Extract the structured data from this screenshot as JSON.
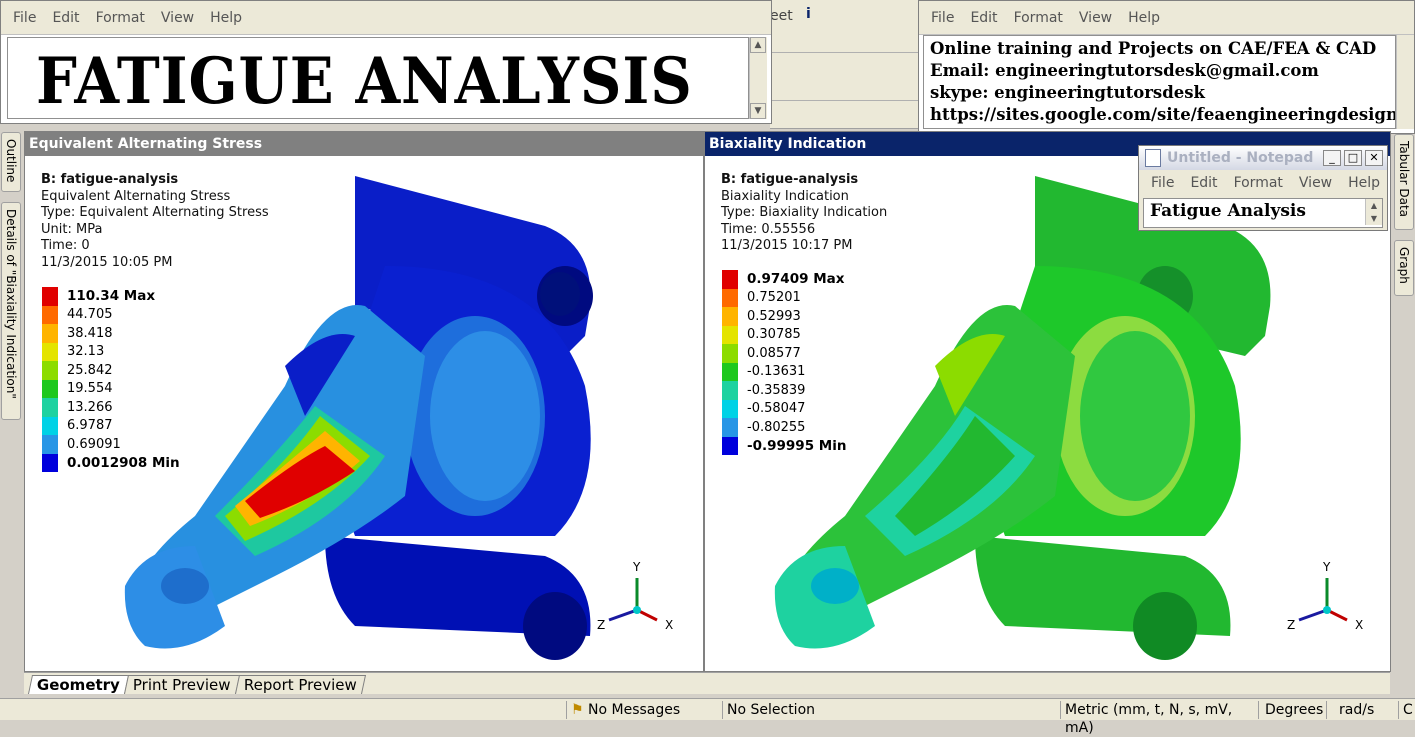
{
  "left_notepad": {
    "menu": [
      "File",
      "Edit",
      "Format",
      "View",
      "Help"
    ],
    "text": "FATIGUE ANALYSIS"
  },
  "bg_toolbar": {
    "partial_text": "eet",
    "info_glyph": "i"
  },
  "right_notepad": {
    "menu": [
      "File",
      "Edit",
      "Format",
      "View",
      "Help"
    ],
    "lines": [
      "Online training and Projects on CAE/FEA & CAD",
      "Email: engineeringtutorsdesk@gmail.com",
      "skype: engineeringtutorsdesk",
      "https://sites.google.com/site/feaengineeringdesign/"
    ]
  },
  "small_notepad": {
    "title": "Untitled - Notepad",
    "menu": [
      "File",
      "Edit",
      "Format",
      "View",
      "Help"
    ],
    "text": "Fatigue Analysis"
  },
  "side_tabs": {
    "left": [
      "Outline",
      "Details of \"Biaxiality Indication\""
    ],
    "right": [
      "Tabular Data",
      "Graph"
    ]
  },
  "panel_left": {
    "title": "Equivalent Alternating Stress",
    "info": {
      "system": "B: fatigue-analysis",
      "result": "Equivalent Alternating Stress",
      "type": "Type: Equivalent Alternating Stress",
      "unit": "Unit: MPa",
      "time": "Time: 0",
      "date": "11/3/2015 10:05 PM"
    },
    "legend": [
      {
        "label": "110.34 Max",
        "color": "#e00000",
        "bold": true
      },
      {
        "label": "44.705",
        "color": "#ff6a00"
      },
      {
        "label": "38.418",
        "color": "#ffb400"
      },
      {
        "label": "32.13",
        "color": "#e4e400"
      },
      {
        "label": "25.842",
        "color": "#8cdc00"
      },
      {
        "label": "19.554",
        "color": "#1ec81e"
      },
      {
        "label": "13.266",
        "color": "#1ed2a0"
      },
      {
        "label": "6.9787",
        "color": "#00d2e6"
      },
      {
        "label": "0.69091",
        "color": "#2896e6"
      },
      {
        "label": "0.0012908 Min",
        "color": "#0000dc",
        "bold": true
      }
    ]
  },
  "panel_right": {
    "title": "Biaxiality Indication",
    "info": {
      "system": "B: fatigue-analysis",
      "result": "Biaxiality Indication",
      "type": "Type: Biaxiality Indication",
      "time": "Time: 0.55556",
      "date": "11/3/2015 10:17 PM"
    },
    "legend": [
      {
        "label": "0.97409 Max",
        "color": "#e00000",
        "bold": true
      },
      {
        "label": "0.75201",
        "color": "#ff6a00"
      },
      {
        "label": "0.52993",
        "color": "#ffb400"
      },
      {
        "label": "0.30785",
        "color": "#e4e400"
      },
      {
        "label": "0.08577",
        "color": "#8cdc00"
      },
      {
        "label": "-0.13631",
        "color": "#1ec81e"
      },
      {
        "label": "-0.35839",
        "color": "#1ed2a0"
      },
      {
        "label": "-0.58047",
        "color": "#00d2e6"
      },
      {
        "label": "-0.80255",
        "color": "#2896e6"
      },
      {
        "label": "-0.99995 Min",
        "color": "#0000dc",
        "bold": true
      }
    ]
  },
  "triad": {
    "x": "X",
    "y": "Y",
    "z": "Z"
  },
  "bottom_tabs": [
    "Geometry",
    "Print Preview",
    "Report Preview"
  ],
  "status": {
    "messages": "No Messages",
    "selection": "No Selection",
    "units": "Metric (mm, t, N, s, mV, mA)",
    "angle": "Degrees",
    "rate": "rad/s",
    "extra": "C"
  },
  "colors": {
    "active_title": "#0a246a",
    "inactive_title": "#808080",
    "stress_blue": "#0a1ec8",
    "biax_green": "#22b830"
  }
}
